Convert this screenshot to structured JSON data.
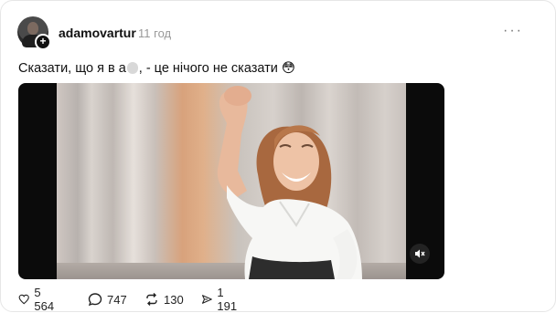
{
  "post": {
    "username": "adamovartur",
    "timestamp": "11 год",
    "more_menu": "···",
    "text_before": "Сказати, що я в а",
    "text_after": ", - це нічого не сказати",
    "emoji": "😳"
  },
  "video": {
    "muted": true,
    "mute_icon": "speaker-muted-icon"
  },
  "actions": {
    "likes": "5 564",
    "comments": "747",
    "reposts": "130",
    "shares": "1 191"
  },
  "colors": {
    "text": "#111111",
    "muted_text": "#999999",
    "video_bg": "#0b0b0b"
  }
}
